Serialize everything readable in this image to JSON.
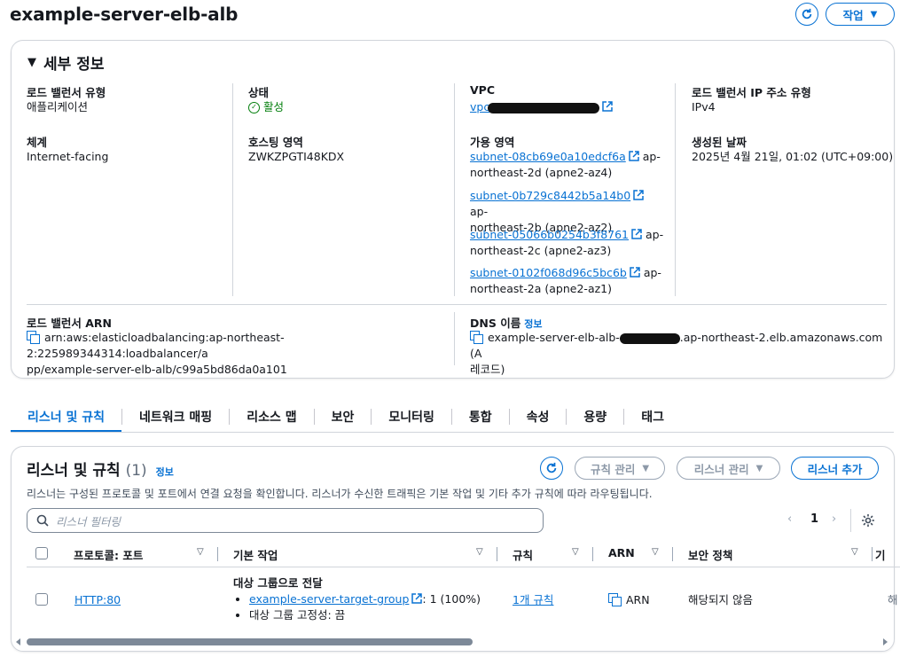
{
  "header": {
    "title": "example-server-elb-alb",
    "action_label": "작업"
  },
  "details": {
    "title": "세부 정보",
    "lb_type_label": "로드 밸런서 유형",
    "lb_type_value": "애플리케이션",
    "scheme_label": "체계",
    "scheme_value": "Internet-facing",
    "state_label": "상태",
    "state_value": "활성",
    "hosted_zone_label": "호스팅 영역",
    "hosted_zone_value": "ZWKZPGTI48KDX",
    "vpc_label": "VPC",
    "vpc_prefix": "vpc",
    "az_label": "가용 영역",
    "subnets": [
      {
        "id": "subnet-08cb69e0a10edcf6a",
        "line1_suffix": "ap-",
        "line2": "northeast-2d (apne2-az4)"
      },
      {
        "id": "subnet-0b729c8442b5a14b0",
        "line1_suffix": "ap-",
        "line2": "northeast-2b (apne2-az2)"
      },
      {
        "id": "subnet-05066b0254b3f8761",
        "line1_suffix": "ap-",
        "line2": "northeast-2c (apne2-az3)"
      },
      {
        "id": "subnet-0102f068d96c5bc6b",
        "line1_suffix": "ap-",
        "line2": "northeast-2a (apne2-az1)"
      }
    ],
    "ip_type_label": "로드 밸런서 IP 주소 유형",
    "ip_type_value": "IPv4",
    "created_label": "생성된 날짜",
    "created_value": "2025년 4월 21일, 01:02 (UTC+09:00)",
    "arn_label": "로드 밸런서 ARN",
    "arn_line1": "arn:aws:elasticloadbalancing:ap-northeast-2:225989344314:loadbalancer/a",
    "arn_line2": "pp/example-server-elb-alb/c99a5bd86da0a101",
    "dns_label": "DNS 이름",
    "dns_info": "정보",
    "dns_prefix": "example-server-elb-alb-",
    "dns_suffix": ".ap-northeast-2.elb.amazonaws.com (A",
    "dns_line2": "레코드)"
  },
  "tabs": [
    {
      "label": "리스너 및 규칙",
      "active": true
    },
    {
      "label": "네트워크 매핑"
    },
    {
      "label": "리소스 맵"
    },
    {
      "label": "보안"
    },
    {
      "label": "모니터링"
    },
    {
      "label": "통합"
    },
    {
      "label": "속성"
    },
    {
      "label": "용량"
    },
    {
      "label": "태그"
    }
  ],
  "listeners": {
    "title": "리스너 및 규칙",
    "count": "(1)",
    "info": "정보",
    "manage_rules_label": "규칙 관리",
    "manage_listener_label": "리스너 관리",
    "add_listener_label": "리스너 추가",
    "description": "리스너는 구성된 프로토콜 및 포트에서 연결 요청을 확인합니다. 리스너가 수신한 트래픽은 기본 작업 및 기타 추가 규칙에 따라 라우팅됩니다.",
    "filter_placeholder": "리스너 필터링",
    "page": "1",
    "columns": [
      "프로토콜: 포트",
      "기본 작업",
      "규칙",
      "ARN",
      "보안 정책",
      "기"
    ],
    "row": {
      "protocol_port": "HTTP:80",
      "action_title": "대상 그룹으로 전달",
      "target_group": "example-server-target-group",
      "target_weight": ": 1 (100%)",
      "stickiness": "대상 그룹 고정성: 끔",
      "rules": "1개 규칙",
      "arn": "ARN",
      "security_policy": "해당되지 않음",
      "extra": "해"
    }
  }
}
